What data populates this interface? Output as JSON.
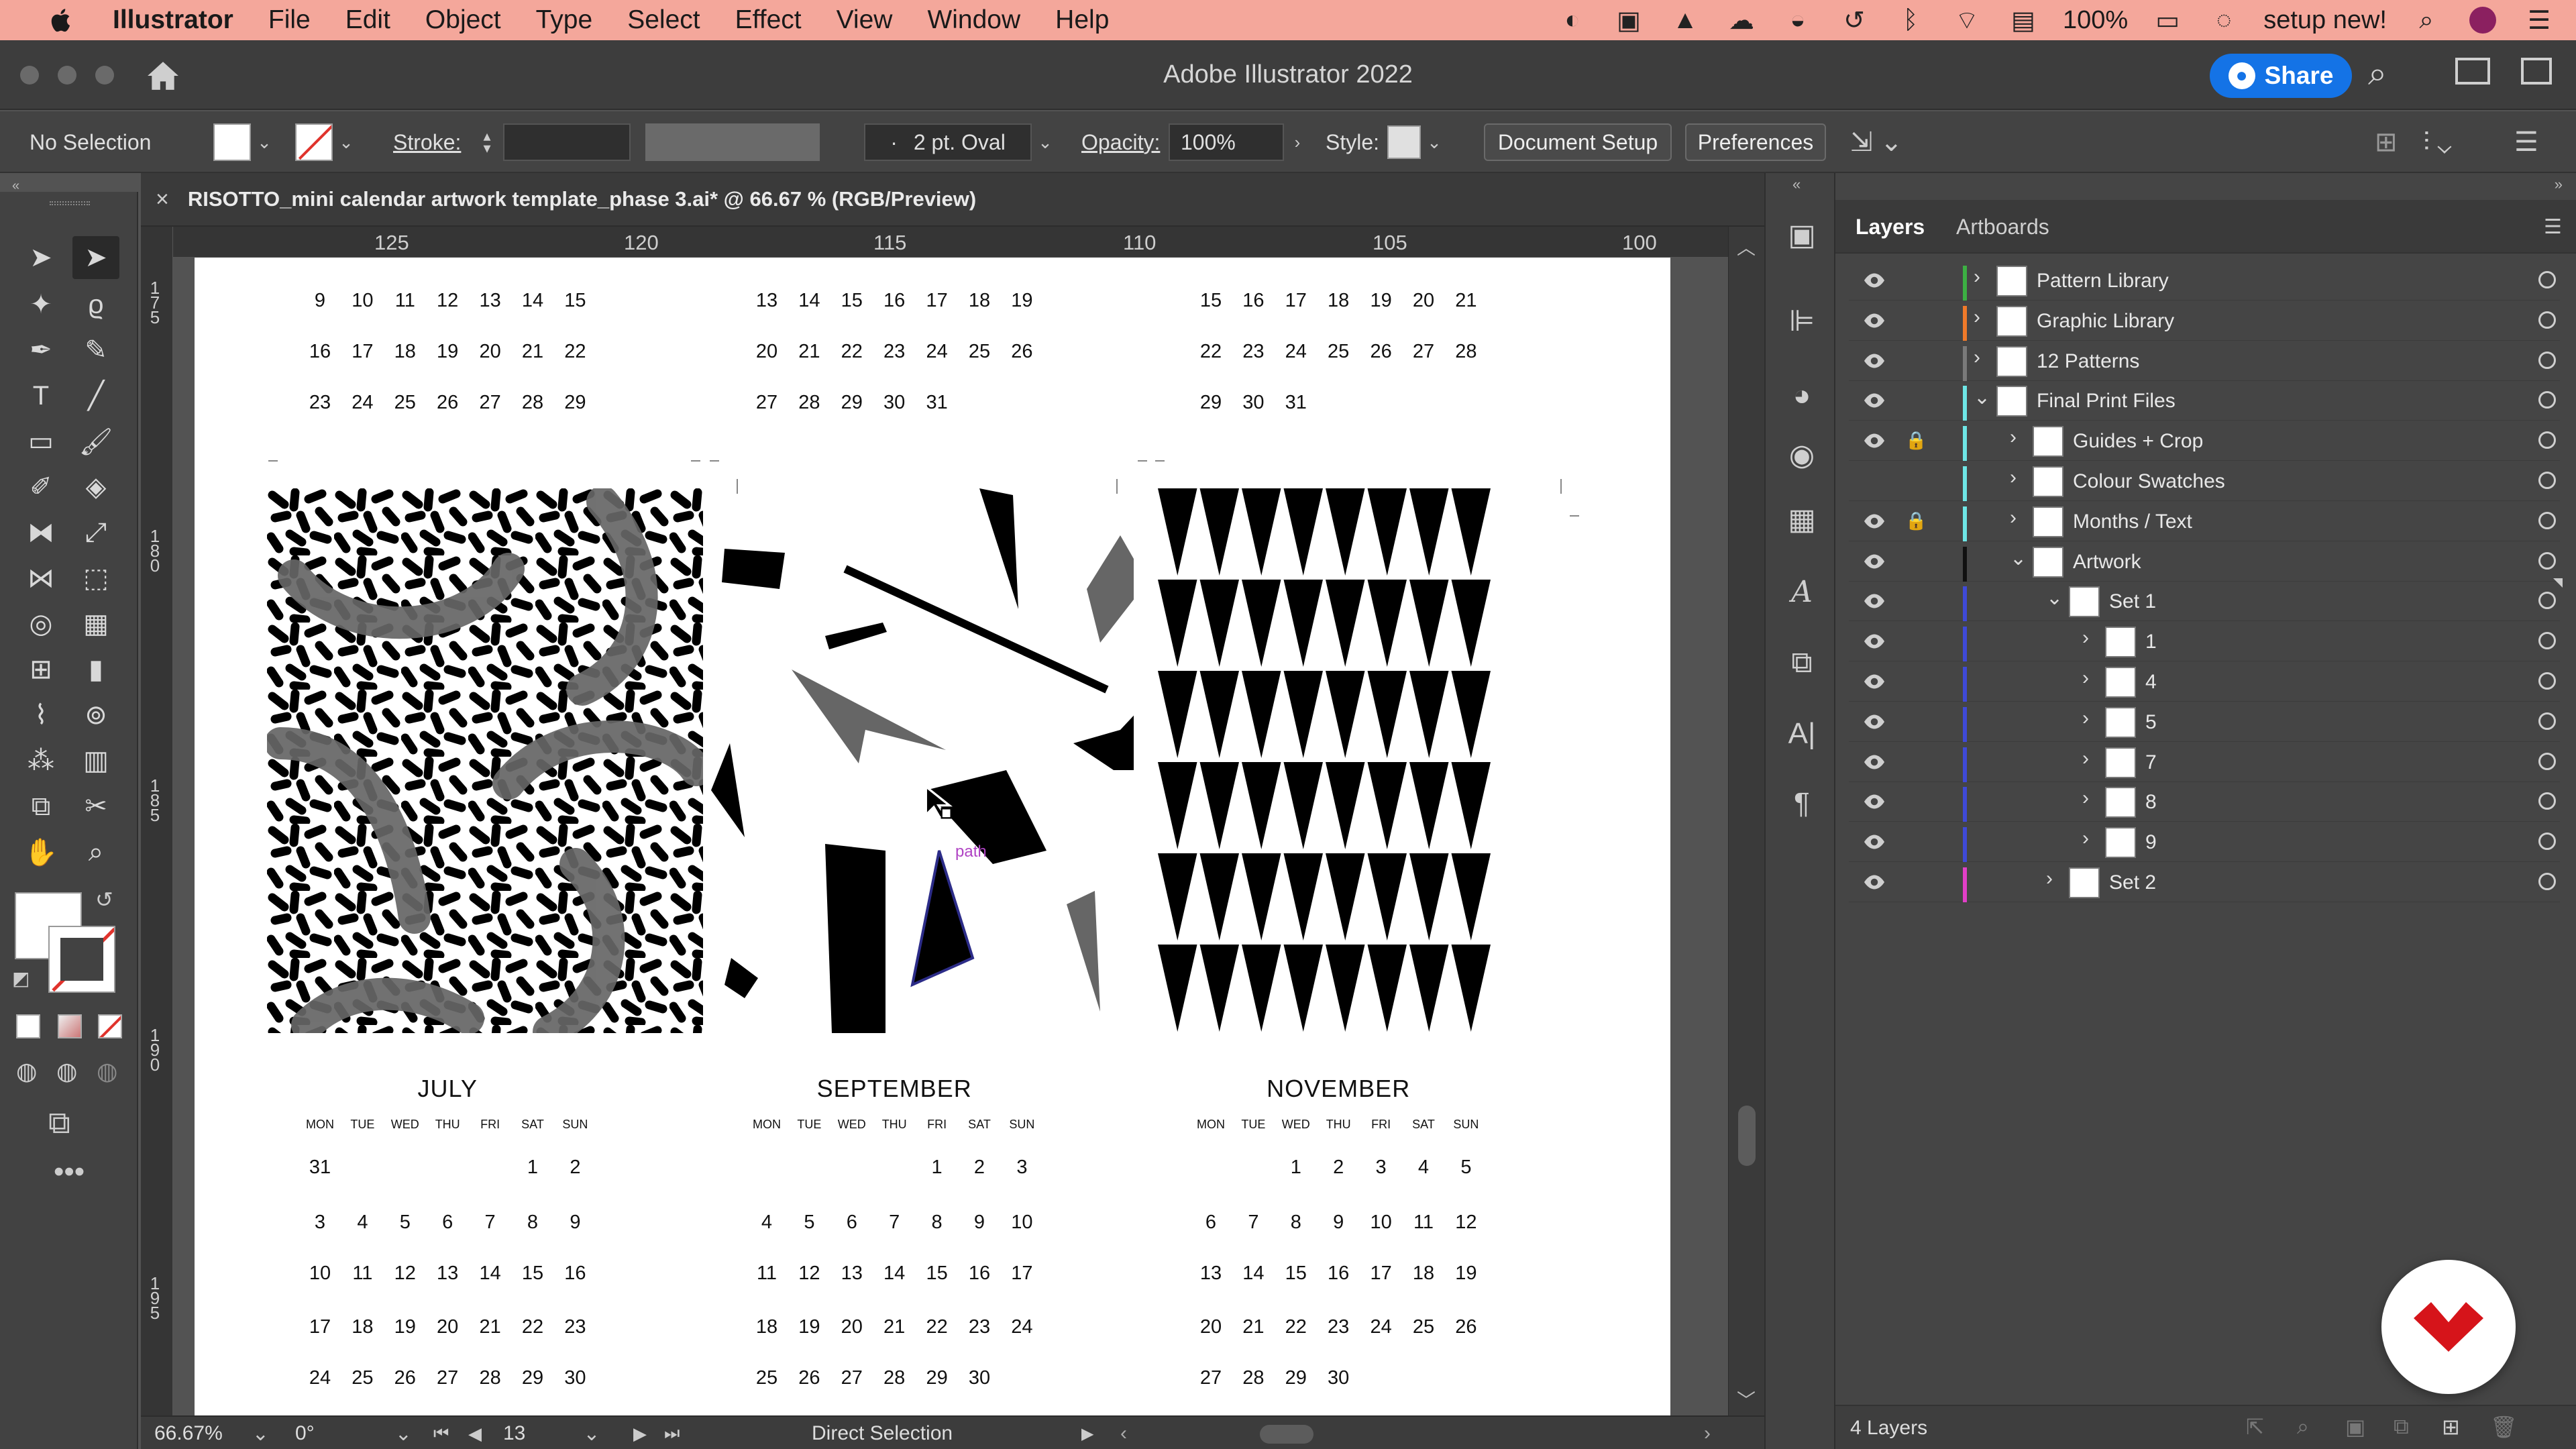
{
  "menubar": {
    "app_name": "Illustrator",
    "items": [
      "File",
      "Edit",
      "Object",
      "Type",
      "Select",
      "Effect",
      "View",
      "Window",
      "Help"
    ],
    "battery": "100%",
    "user": "setup new!"
  },
  "titlebar": {
    "title": "Adobe Illustrator 2022",
    "share_label": "Share"
  },
  "controlbar": {
    "selection": "No Selection",
    "stroke_label": "Stroke:",
    "brush": "2 pt. Oval",
    "opacity_label": "Opacity:",
    "opacity_value": "100%",
    "style_label": "Style:",
    "document_setup": "Document Setup",
    "preferences": "Preferences"
  },
  "document": {
    "tab_title": "RISOTTO_mini calendar artwork template_phase 3.ai* @ 66.67 % (RGB/Preview)",
    "ruler_top": [
      "125",
      "120",
      "115",
      "110",
      "105",
      "100"
    ],
    "ruler_left": [
      [
        "1",
        "7",
        "5"
      ],
      [
        "1",
        "8",
        "0"
      ],
      [
        "1",
        "8",
        "5"
      ],
      [
        "1",
        "9",
        "0"
      ],
      [
        "1",
        "9",
        "5"
      ]
    ],
    "path_label": "path"
  },
  "calendar": {
    "top_weeks": {
      "col1": [
        [
          "9",
          "10",
          "11",
          "12",
          "13",
          "14",
          "15"
        ],
        [
          "16",
          "17",
          "18",
          "19",
          "20",
          "21",
          "22"
        ],
        [
          "23",
          "24",
          "25",
          "26",
          "27",
          "28",
          "29"
        ]
      ],
      "col2": [
        [
          "13",
          "14",
          "15",
          "16",
          "17",
          "18",
          "19"
        ],
        [
          "20",
          "21",
          "22",
          "23",
          "24",
          "25",
          "26"
        ],
        [
          "27",
          "28",
          "29",
          "30",
          "31",
          "",
          ""
        ]
      ],
      "col3": [
        [
          "15",
          "16",
          "17",
          "18",
          "19",
          "20",
          "21"
        ],
        [
          "22",
          "23",
          "24",
          "25",
          "26",
          "27",
          "28"
        ],
        [
          "29",
          "30",
          "31",
          "",
          "",
          "",
          ""
        ]
      ]
    },
    "days": [
      "MON",
      "TUE",
      "WED",
      "THU",
      "FRI",
      "SAT",
      "SUN"
    ],
    "months": [
      {
        "name": "JULY",
        "weeks": [
          [
            "31",
            "",
            "",
            "",
            "",
            "1",
            "2"
          ],
          [
            "3",
            "4",
            "5",
            "6",
            "7",
            "8",
            "9"
          ],
          [
            "10",
            "11",
            "12",
            "13",
            "14",
            "15",
            "16"
          ],
          [
            "17",
            "18",
            "19",
            "20",
            "21",
            "22",
            "23"
          ],
          [
            "24",
            "25",
            "26",
            "27",
            "28",
            "29",
            "30"
          ]
        ]
      },
      {
        "name": "SEPTEMBER",
        "weeks": [
          [
            "",
            "",
            "",
            "",
            "1",
            "2",
            "3"
          ],
          [
            "4",
            "5",
            "6",
            "7",
            "8",
            "9",
            "10"
          ],
          [
            "11",
            "12",
            "13",
            "14",
            "15",
            "16",
            "17"
          ],
          [
            "18",
            "19",
            "20",
            "21",
            "22",
            "23",
            "24"
          ],
          [
            "25",
            "26",
            "27",
            "28",
            "29",
            "30",
            ""
          ]
        ]
      },
      {
        "name": "NOVEMBER",
        "weeks": [
          [
            "",
            "",
            "1",
            "2",
            "3",
            "4",
            "5"
          ],
          [
            "6",
            "7",
            "8",
            "9",
            "10",
            "11",
            "12"
          ],
          [
            "13",
            "14",
            "15",
            "16",
            "17",
            "18",
            "19"
          ],
          [
            "20",
            "21",
            "22",
            "23",
            "24",
            "25",
            "26"
          ],
          [
            "27",
            "28",
            "29",
            "30",
            "",
            "",
            ""
          ]
        ]
      }
    ]
  },
  "statusbar": {
    "zoom": "66.67%",
    "rotate": "0°",
    "artboard": "13",
    "tool": "Direct Selection"
  },
  "layers_panel": {
    "tabs": [
      "Layers",
      "Artboards"
    ],
    "footer": "4 Layers",
    "rows": [
      {
        "name": "Pattern Library",
        "color": "#3cb043"
      },
      {
        "name": "Graphic Library",
        "color": "#f07a2a"
      },
      {
        "name": "12 Patterns",
        "color": "#7a7a7a"
      },
      {
        "name": "Final Print Files",
        "color": "#6ee6e6"
      },
      {
        "name": "Guides + Crop",
        "color": "#6ee6e6"
      },
      {
        "name": "Colour Swatches",
        "color": "#6ee6e6"
      },
      {
        "name": "Months / Text",
        "color": "#6ee6e6"
      },
      {
        "name": "Artwork",
        "color": "#111111"
      },
      {
        "name": "Set 1",
        "color": "#3f4ad8"
      },
      {
        "name": "1",
        "color": "#3f4ad8"
      },
      {
        "name": "4",
        "color": "#3f4ad8"
      },
      {
        "name": "5",
        "color": "#3f4ad8"
      },
      {
        "name": "7",
        "color": "#3f4ad8"
      },
      {
        "name": "8",
        "color": "#3f4ad8"
      },
      {
        "name": "9",
        "color": "#3f4ad8"
      },
      {
        "name": "Set 2",
        "color": "#e23fc8"
      }
    ]
  }
}
